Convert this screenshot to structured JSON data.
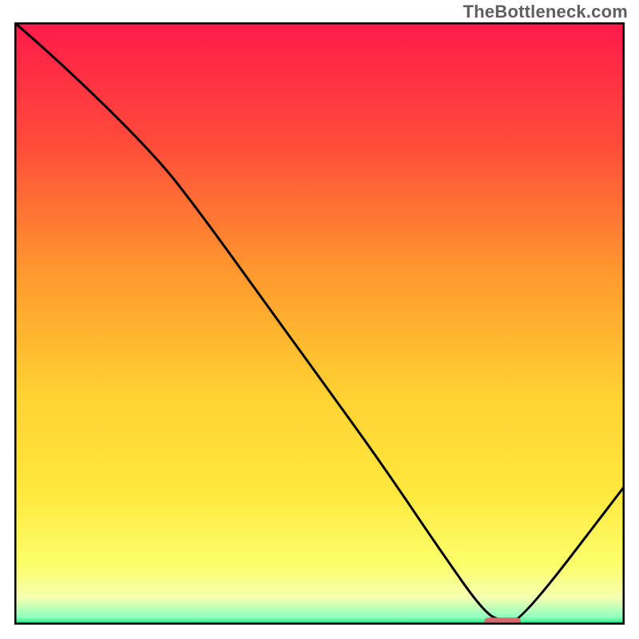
{
  "watermark": "TheBottleneck.com",
  "colors": {
    "line": "#000000",
    "frame": "#000000",
    "marker": "#d46a6a",
    "gradient_stops": [
      {
        "offset": 0.0,
        "color": "#ff1a4b"
      },
      {
        "offset": 0.2,
        "color": "#ff4b3a"
      },
      {
        "offset": 0.42,
        "color": "#ff9a2e"
      },
      {
        "offset": 0.62,
        "color": "#ffd232"
      },
      {
        "offset": 0.78,
        "color": "#ffe83e"
      },
      {
        "offset": 0.9,
        "color": "#fcff6a"
      },
      {
        "offset": 0.955,
        "color": "#f6ffb0"
      },
      {
        "offset": 0.988,
        "color": "#8fffc0"
      },
      {
        "offset": 1.0,
        "color": "#00e56a"
      }
    ]
  },
  "chart_data": {
    "type": "line",
    "title": "",
    "xlabel": "",
    "ylabel": "",
    "xlim": [
      0,
      100
    ],
    "ylim": [
      0,
      100
    ],
    "x": [
      0,
      8,
      23,
      30,
      40,
      50,
      60,
      70,
      77,
      80,
      83,
      100
    ],
    "values": [
      100,
      93,
      78,
      69,
      55,
      41,
      27,
      12,
      2,
      0.5,
      0.5,
      23
    ],
    "marker_segment": {
      "x0": 77,
      "x1": 83,
      "y": 0.5
    }
  }
}
